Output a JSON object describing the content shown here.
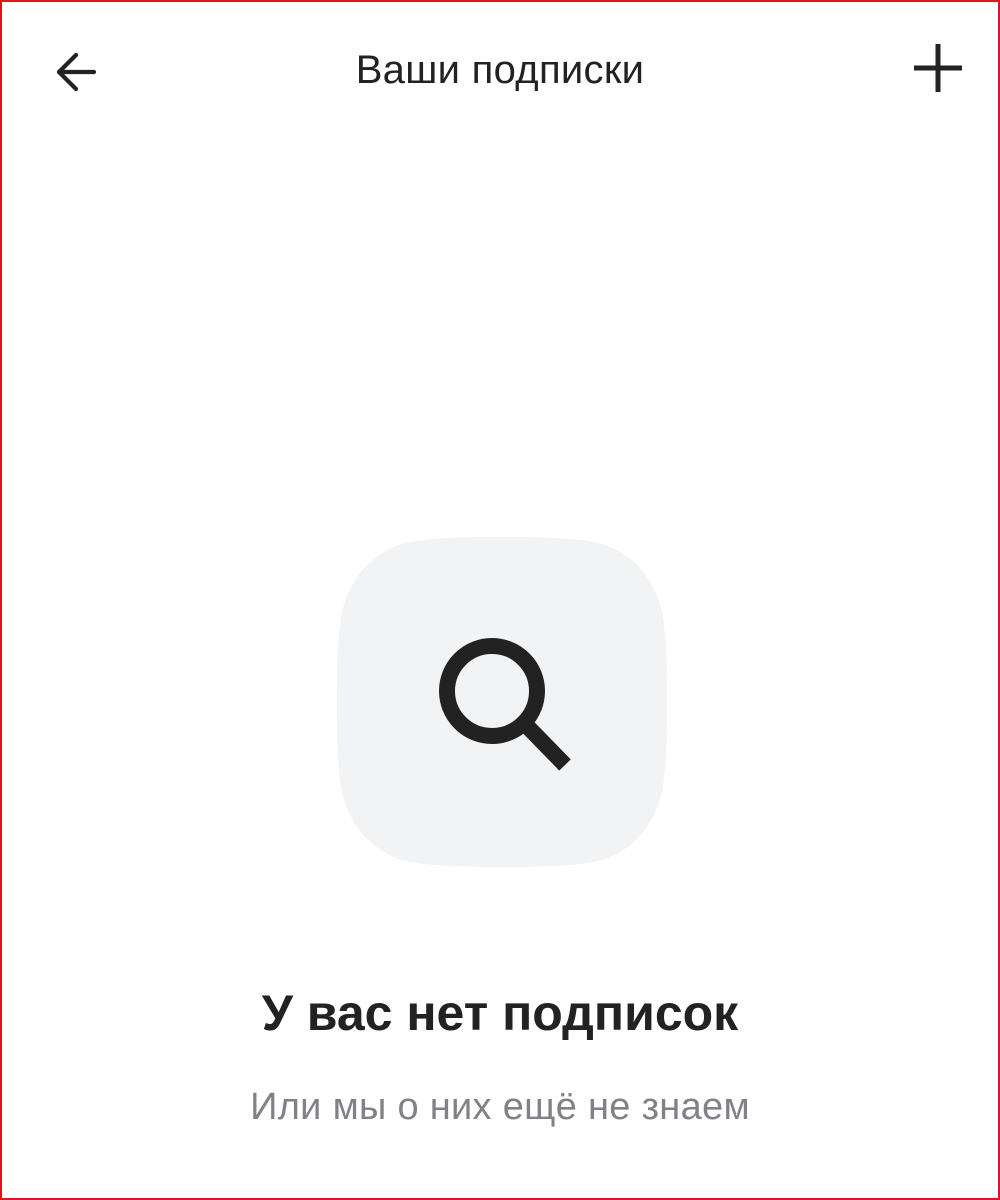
{
  "header": {
    "title": "Ваши подписки",
    "back_icon": "arrow-left-icon",
    "add_icon": "plus-icon"
  },
  "empty_state": {
    "icon": "search-icon",
    "title": "У вас нет подписок",
    "subtitle": "Или мы о них ещё не знаем"
  },
  "colors": {
    "border": "#e0141e",
    "icon_bg": "#f2f3f5",
    "text_primary": "#222222",
    "text_secondary": "#818188"
  }
}
